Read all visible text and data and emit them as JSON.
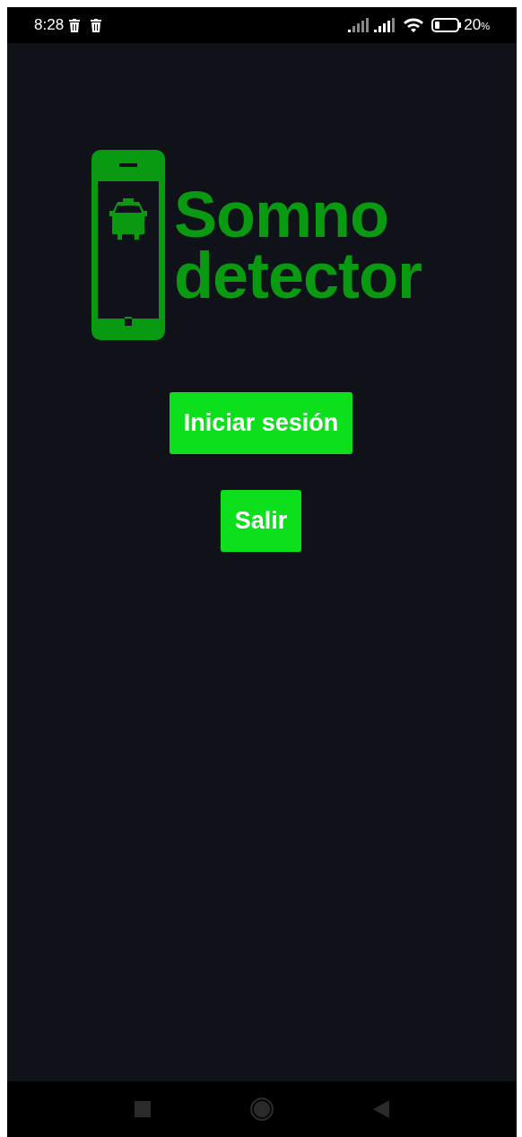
{
  "status_bar": {
    "time": "8:28",
    "battery": "20",
    "battery_unit": "%"
  },
  "logo": {
    "lines": [
      "Somno",
      "detector"
    ]
  },
  "buttons": [
    "Iniciar sesión",
    "Salir"
  ]
}
